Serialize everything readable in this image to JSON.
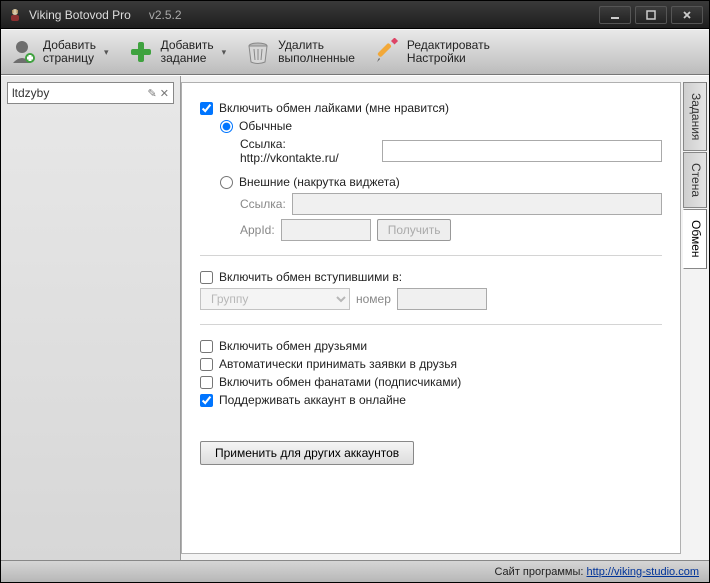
{
  "window": {
    "title": "Viking Botovod Pro",
    "version": "v2.5.2"
  },
  "toolbar": {
    "add_page": {
      "line1": "Добавить",
      "line2": "страницу"
    },
    "add_task": {
      "line1": "Добавить",
      "line2": "задание"
    },
    "delete_done": {
      "line1": "Удалить",
      "line2": "выполненные"
    },
    "edit_settings": {
      "line1": "Редактировать",
      "line2": "Настройки"
    }
  },
  "sidebar": {
    "account": "ltdzyby"
  },
  "tabs": {
    "tasks": "Задания",
    "wall": "Стена",
    "exchange": "Обмен"
  },
  "form": {
    "likes_enable": "Включить обмен лайками (мне нравится)",
    "likes_normal": "Обычные",
    "likes_link_label": "Ссылка: http://vkontakte.ru/",
    "likes_link_value": "",
    "likes_external": "Внешние (накрутка виджета)",
    "ext_link_label": "Ссылка:",
    "ext_link_value": "",
    "appid_label": "AppId:",
    "appid_value": "",
    "get_btn": "Получить",
    "join_enable": "Включить обмен вступившими в:",
    "join_target": "Группу",
    "join_number_label": "номер",
    "join_number_value": "",
    "friends_enable": "Включить обмен друзьями",
    "auto_accept": "Автоматически принимать заявки в друзья",
    "fans_enable": "Включить обмен фанатами (подписчиками)",
    "keep_online": "Поддерживать аккаунт в онлайне",
    "apply_btn": "Применить для других аккаунтов"
  },
  "statusbar": {
    "label": "Сайт программы:",
    "link": "http://viking-studio.com"
  }
}
